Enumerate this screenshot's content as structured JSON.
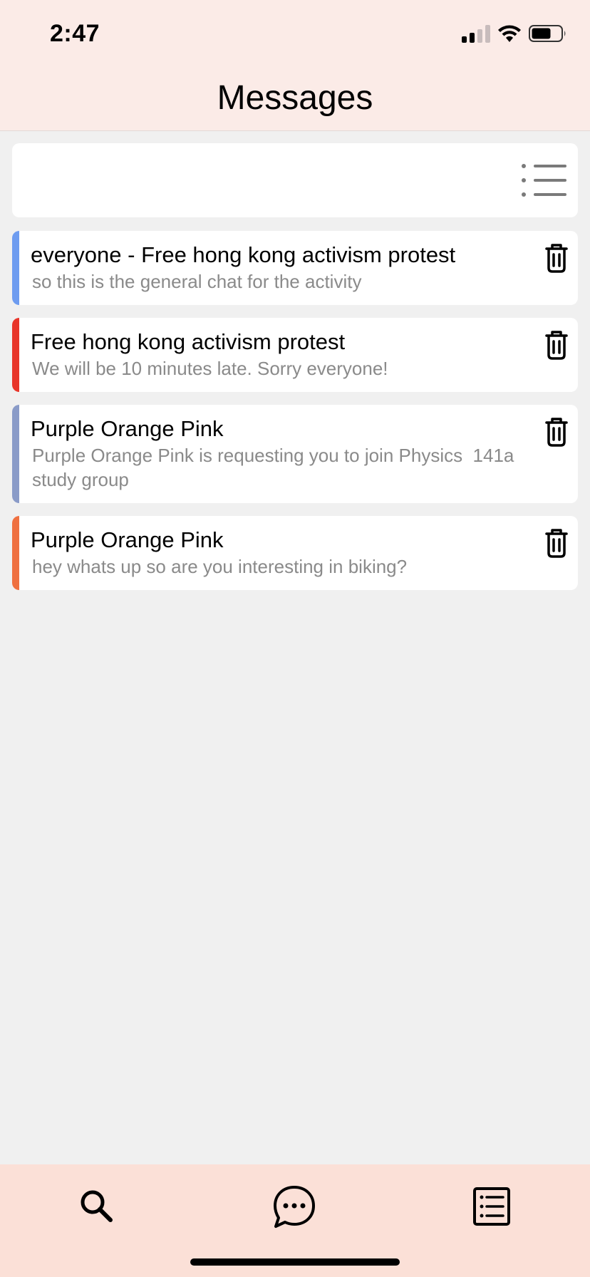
{
  "status_bar": {
    "time": "2:47"
  },
  "header": {
    "title": "Messages"
  },
  "filter": {
    "icon": "list-filter-icon"
  },
  "messages": [
    {
      "title": "everyone - Free hong kong activism protest",
      "preview": "so this is the general chat for the activity",
      "accent_color": "#6e9cf0"
    },
    {
      "title": "Free hong kong activism protest",
      "preview": "We will be 10 minutes late. Sorry everyone!",
      "accent_color": "#e8352a"
    },
    {
      "title": "Purple Orange Pink",
      "preview": "Purple Orange Pink is requesting you to join Physics  141a study group",
      "accent_color": "#8a9bc8"
    },
    {
      "title": "Purple Orange Pink",
      "preview": "hey whats up so are you interesting in biking?",
      "accent_color": "#ef7040"
    }
  ],
  "tabbar": {
    "tabs": [
      {
        "icon": "search-icon"
      },
      {
        "icon": "chat-bubble-icon"
      },
      {
        "icon": "list-document-icon"
      }
    ]
  },
  "colors": {
    "header_bg": "#fbebe7",
    "tabbar_bg": "#fbe0d7",
    "page_bg": "#f0f0f0"
  }
}
